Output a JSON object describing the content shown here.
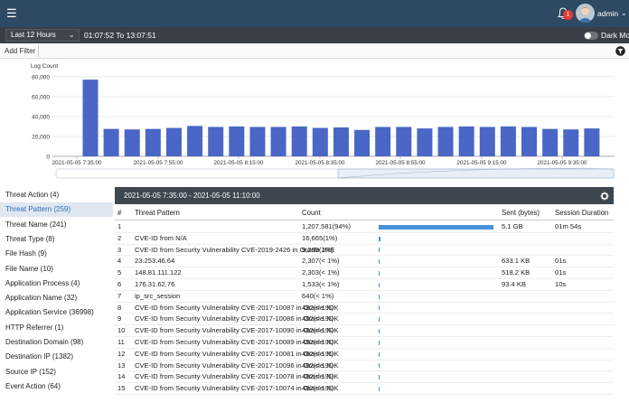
{
  "header": {
    "notification_count": "1",
    "username": "admin"
  },
  "timebar": {
    "range": "Last 12 Hours",
    "range_text": "01:07:52 To 13:07:51",
    "dark_mode_label": "Dark Mode"
  },
  "filter": {
    "add_label": "Add Filter"
  },
  "chart_data": {
    "type": "bar",
    "ylabel": "Log Count",
    "yticks": [
      "0",
      "20,000",
      "40,000",
      "60,000",
      "80,000"
    ],
    "ylim": [
      0,
      88000
    ],
    "x_tick_labels": [
      "2021-05-05 7:35:00",
      "2021-05-05 7:55:00",
      "2021-05-05 8:15:00",
      "2021-05-05 8:35:00",
      "2021-05-05 8:55:00",
      "2021-05-05 9:15:00",
      "2021-05-05 9:35:00"
    ],
    "values": [
      77000,
      27500,
      27000,
      27500,
      28500,
      30500,
      29500,
      30000,
      29500,
      29500,
      30000,
      28500,
      29000,
      26500,
      29500,
      29500,
      28000,
      29500,
      30000,
      29500,
      30000,
      29500,
      27500,
      27000,
      28000
    ],
    "grid": true,
    "color": "#4a66c6"
  },
  "nav": {
    "items": [
      {
        "label": "Threat Action (4)"
      },
      {
        "label": "Threat Pattern (259)"
      },
      {
        "label": "Threat Name (241)"
      },
      {
        "label": "Threat Type (8)"
      },
      {
        "label": "File Hash (9)"
      },
      {
        "label": "File Name (10)"
      },
      {
        "label": "Application Process (4)"
      },
      {
        "label": "Application Name (32)"
      },
      {
        "label": "Application Service (36998)"
      },
      {
        "label": "HTTP Referrer (1)"
      },
      {
        "label": "Destination Domain (98)"
      },
      {
        "label": "Destination IP (1382)"
      },
      {
        "label": "Source IP (152)"
      },
      {
        "label": "Event Action (64)"
      }
    ],
    "active_index": 1
  },
  "panel": {
    "title": "2021-05-05 7:35:00 - 2021-05-05 11:10:00",
    "columns": {
      "idx": "#",
      "pattern": "Threat Pattern",
      "count": "Count",
      "sent": "Sent (bytes)",
      "duration": "Session Duration"
    },
    "rows": [
      {
        "idx": "1",
        "pattern": "",
        "count": "1,207,581(94%)",
        "bar": 0.94,
        "sent": "5.1 GB",
        "duration": "01m 54s"
      },
      {
        "idx": "2",
        "pattern": "CVE-ID from N/A",
        "count": "16,665(1%)",
        "bar": 0.013,
        "sent": "",
        "duration": ""
      },
      {
        "idx": "3",
        "pattern": "CVE-ID from Security Vulnerability CVE-2019-2426 in Oracle JRE",
        "count": "9,289(1%)",
        "bar": 0.008,
        "sent": "",
        "duration": ""
      },
      {
        "idx": "4",
        "pattern": "23.253.46.64",
        "count": "2,307(< 1%)",
        "bar": 0.002,
        "sent": "633.1 KB",
        "duration": "01s"
      },
      {
        "idx": "5",
        "pattern": "148.81.111.122",
        "count": "2,303(< 1%)",
        "bar": 0.002,
        "sent": "518.2 KB",
        "duration": "01s"
      },
      {
        "idx": "6",
        "pattern": "176.31.62.76",
        "count": "1,533(< 1%)",
        "bar": 0.001,
        "sent": "93.4 KB",
        "duration": "10s"
      },
      {
        "idx": "7",
        "pattern": "ip_src_session",
        "count": "640(< 1%)",
        "bar": 0.0005,
        "sent": "",
        "duration": ""
      },
      {
        "idx": "8",
        "pattern": "CVE-ID from Security Vulnerability CVE-2017-10087 in Oracle JDK",
        "count": "482(< 1%)",
        "bar": 0.0004,
        "sent": "",
        "duration": ""
      },
      {
        "idx": "9",
        "pattern": "CVE-ID from Security Vulnerability CVE-2017-10086 in Oracle JDK",
        "count": "482(< 1%)",
        "bar": 0.0004,
        "sent": "",
        "duration": ""
      },
      {
        "idx": "10",
        "pattern": "CVE-ID from Security Vulnerability CVE-2017-10090 in Oracle JDK",
        "count": "482(< 1%)",
        "bar": 0.0004,
        "sent": "",
        "duration": ""
      },
      {
        "idx": "11",
        "pattern": "CVE-ID from Security Vulnerability CVE-2017-10089 in Oracle JDK",
        "count": "482(< 1%)",
        "bar": 0.0004,
        "sent": "",
        "duration": ""
      },
      {
        "idx": "12",
        "pattern": "CVE-ID from Security Vulnerability CVE-2017-10081 in Oracle JDK",
        "count": "482(< 1%)",
        "bar": 0.0004,
        "sent": "",
        "duration": ""
      },
      {
        "idx": "13",
        "pattern": "CVE-ID from Security Vulnerability CVE-2017-10096 in Oracle JDK",
        "count": "482(< 1%)",
        "bar": 0.0004,
        "sent": "",
        "duration": ""
      },
      {
        "idx": "14",
        "pattern": "CVE-ID from Security Vulnerability CVE-2017-10078 in Oracle JDK",
        "count": "482(< 1%)",
        "bar": 0.0004,
        "sent": "",
        "duration": ""
      },
      {
        "idx": "15",
        "pattern": "CVE-ID from Security Vulnerability CVE-2017-10074 in Oracle JDK",
        "count": "482(< 1%)",
        "bar": 0.0004,
        "sent": "",
        "duration": ""
      }
    ]
  },
  "icons": {
    "menu": "hamburger-icon",
    "bell": "bell-icon",
    "filter": "funnel-icon",
    "panel": "settings-icon"
  }
}
